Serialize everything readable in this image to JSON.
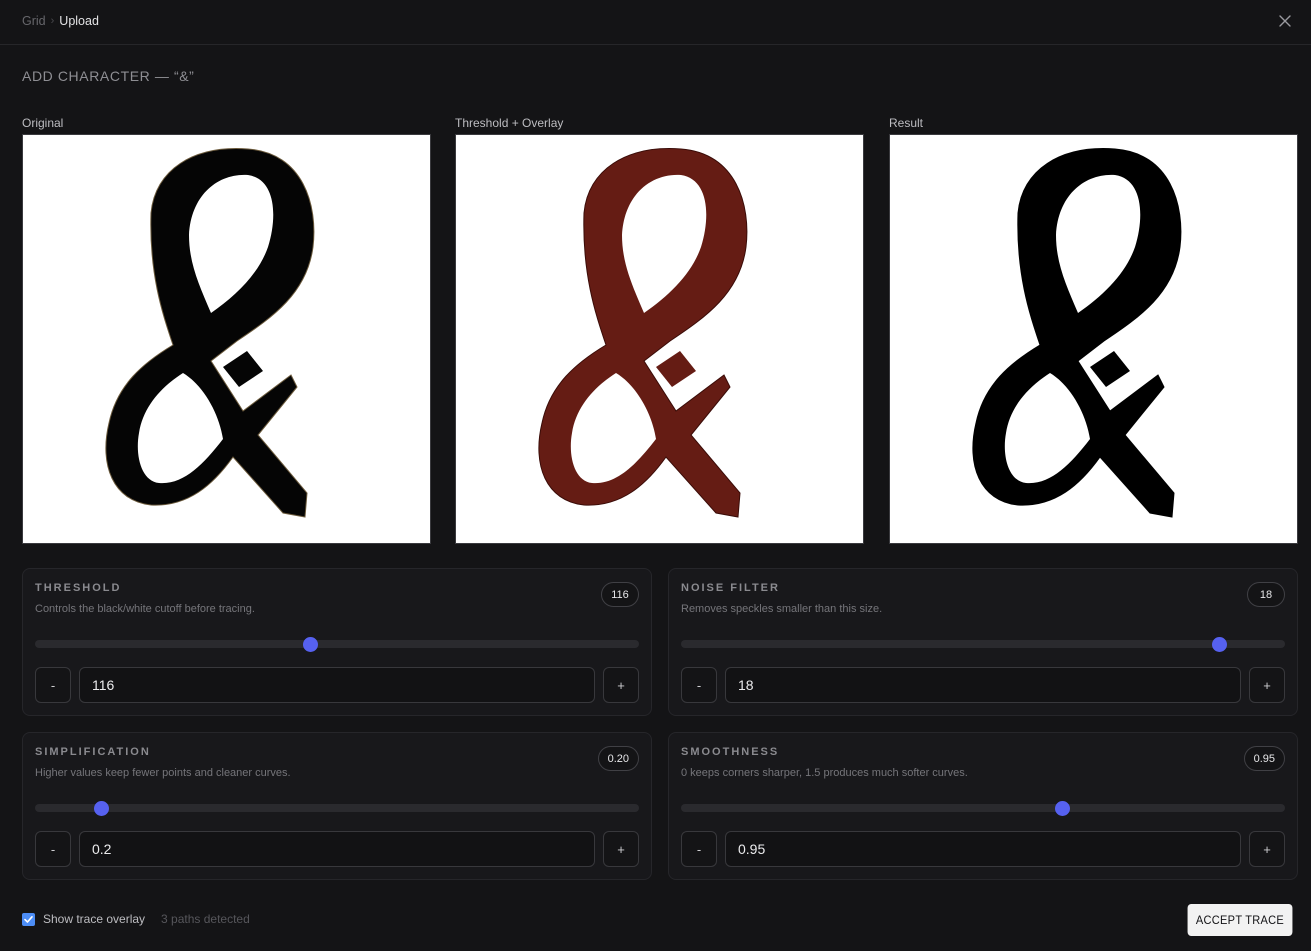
{
  "breadcrumb": {
    "root": "Grid",
    "separator": "›",
    "current": "Upload"
  },
  "header": {
    "close_icon": "close-icon"
  },
  "title": "ADD CHARACTER — “&”",
  "panels": [
    {
      "label": "Original",
      "fill": "#050505",
      "stroke": "#6b5a3c"
    },
    {
      "label": "Threshold + Overlay",
      "fill": "#651c14",
      "stroke": "#3a0c08"
    },
    {
      "label": "Result",
      "fill": "#000000",
      "stroke": "#000000"
    }
  ],
  "controls": {
    "threshold": {
      "label": "THRESHOLD",
      "description": "Controls the black/white cutoff before tracing.",
      "badge": "116",
      "value": "116",
      "position": 0.455,
      "minus": "-",
      "plus": "+"
    },
    "noise": {
      "label": "NOISE FILTER",
      "description": "Removes speckles smaller than this size.",
      "badge": "18",
      "value": "18",
      "position": 0.89,
      "minus": "-",
      "plus": "+"
    },
    "simplification": {
      "label": "SIMPLIFICATION",
      "description": "Higher values keep fewer points and cleaner curves.",
      "badge": "0.20",
      "value": "0.2",
      "position": 0.11,
      "minus": "-",
      "plus": "+"
    },
    "smoothness": {
      "label": "SMOOTHNESS",
      "description": "0 keeps corners sharper, 1.5 produces much softer curves.",
      "badge": "0.95",
      "value": "0.95",
      "position": 0.63,
      "minus": "-",
      "plus": "+"
    }
  },
  "footer": {
    "show_overlay_label": "Show trace overlay",
    "show_overlay_checked": true,
    "paths_text": "3 paths detected",
    "accept_label": "ACCEPT TRACE"
  },
  "colors": {
    "accent": "#5661f0",
    "checkbox": "#4c8df6",
    "background": "#141416"
  }
}
